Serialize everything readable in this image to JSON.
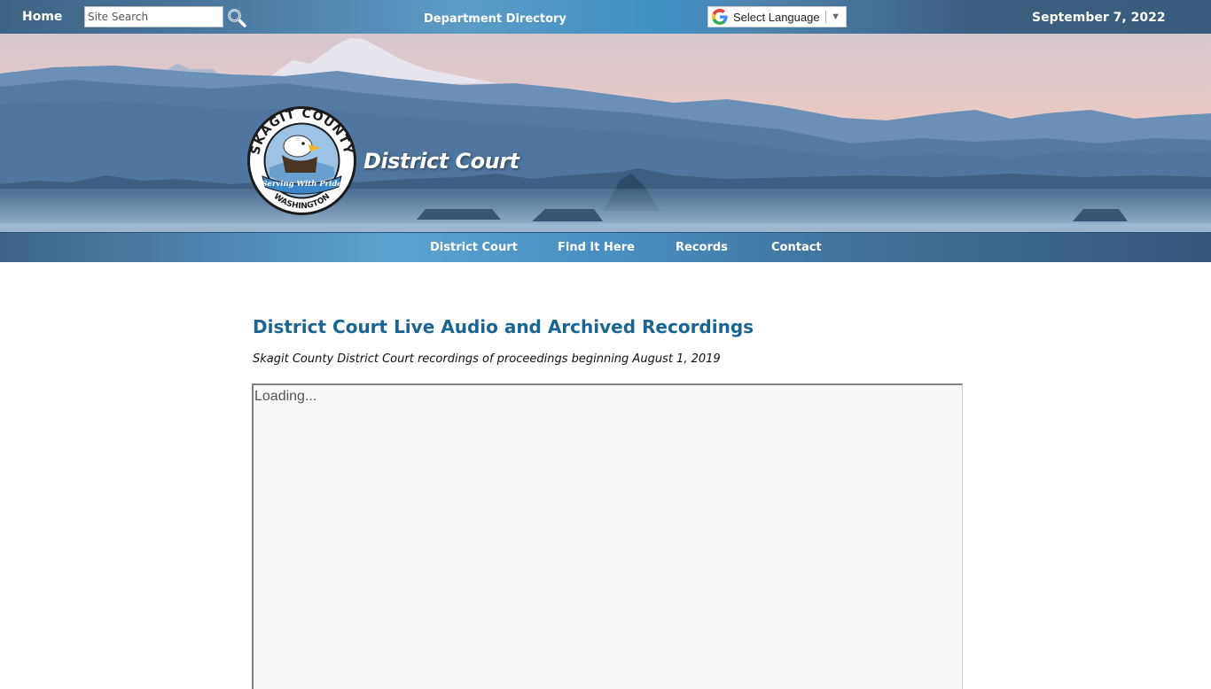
{
  "topbar": {
    "home_label": "Home",
    "search_placeholder": "Site Search",
    "search_icon": "magnifier-icon",
    "department_directory_label": "Department Directory",
    "language_label": "Select Language",
    "language_icon": "google-g-icon",
    "date": "September 7, 2022"
  },
  "banner": {
    "seal_text_top": "SKAGIT COUNTY",
    "seal_ribbon": "Serving With Pride",
    "seal_text_bottom": "WASHINGTON",
    "title": "District Court"
  },
  "nav": {
    "items": [
      {
        "label": "District Court"
      },
      {
        "label": "Find It Here"
      },
      {
        "label": "Records"
      },
      {
        "label": "Contact"
      }
    ]
  },
  "main": {
    "heading": "District Court Live Audio and Archived Recordings",
    "subtitle": "Skagit County District Court recordings of proceedings beginning August 1, 2019",
    "frame_status": "Loading..."
  },
  "colors": {
    "heading": "#1a6594",
    "topbar": "#3e6384",
    "frame_bg": "#f7f8fa"
  }
}
